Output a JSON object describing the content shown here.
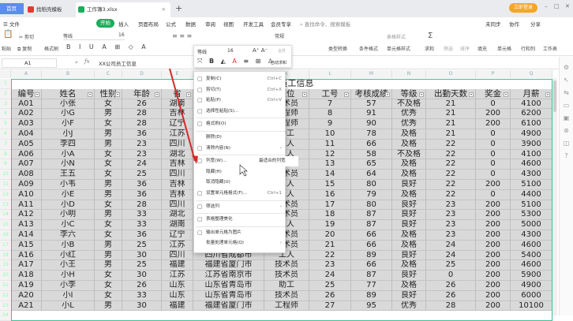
{
  "tabs": {
    "home": "首页",
    "docer": "找稻壳模板",
    "book": "工作簿3.xlsx",
    "login": "立即登录"
  },
  "menubar": {
    "file": "文件",
    "items": [
      "开始",
      "插入",
      "页面布局",
      "公式",
      "数据",
      "审阅",
      "视图",
      "开发工具",
      "会员专享"
    ],
    "search": "查找命令、搜索模板",
    "sync": "未同步",
    "collab": "协作",
    "share": "分享"
  },
  "ribbon": {
    "paste": "粘贴",
    "cut": "剪切",
    "copy": "复制",
    "format_painter": "格式刷",
    "font": "等线",
    "size": "16",
    "number_format": "常规",
    "convert": "类型转换",
    "cond_format": "条件格式",
    "table_style": "表格样式",
    "cell_style": "单元格样式",
    "sum": "求和",
    "filter": "筛选",
    "sort": "排序",
    "fill": "填充",
    "cells": "单元格",
    "rowcol": "行和列",
    "sheet": "工作表"
  },
  "formula": {
    "cell_ref": "A1",
    "fx": "fx",
    "value": "XX公司员工信息"
  },
  "mini_toolbar": {
    "font": "等线",
    "size": "16",
    "merge": "合并",
    "autosum": "自动求和"
  },
  "sheet": {
    "col_letters": [
      "A",
      "B",
      "C",
      "D",
      "E",
      "F",
      "K",
      "L",
      "M",
      "N",
      "O",
      "P",
      "Q"
    ],
    "title": "XX公司员工信息",
    "headers": [
      "编号",
      "姓名",
      "性别",
      "年龄",
      "省",
      "",
      "职位",
      "工号",
      "考核成绩",
      "等级",
      "出勤天数",
      "奖金",
      "月薪"
    ],
    "rows": [
      [
        "A01",
        "小张",
        "女",
        "26",
        "湖南",
        "",
        "技术员",
        "7",
        "57",
        "不及格",
        "21",
        "0",
        "4100"
      ],
      [
        "A02",
        "小G",
        "男",
        "28",
        "吉林",
        "",
        "工程师",
        "8",
        "91",
        "优秀",
        "21",
        "200",
        "6200"
      ],
      [
        "A03",
        "小F",
        "女",
        "28",
        "辽宁",
        "",
        "工程师",
        "9",
        "90",
        "优秀",
        "21",
        "200",
        "6100"
      ],
      [
        "A04",
        "小J",
        "男",
        "36",
        "江苏",
        "",
        "助工",
        "10",
        "78",
        "及格",
        "21",
        "0",
        "4900"
      ],
      [
        "A05",
        "李四",
        "男",
        "23",
        "四川",
        "",
        "工人",
        "11",
        "66",
        "及格",
        "22",
        "0",
        "3900"
      ],
      [
        "A06",
        "小A",
        "女",
        "23",
        "湖北",
        "",
        "工人",
        "12",
        "58",
        "不及格",
        "22",
        "0",
        "4100"
      ],
      [
        "A07",
        "小N",
        "女",
        "24",
        "吉林",
        "",
        "工人",
        "13",
        "65",
        "及格",
        "22",
        "0",
        "4600"
      ],
      [
        "A08",
        "王五",
        "女",
        "25",
        "四川",
        "",
        "技术员",
        "14",
        "64",
        "及格",
        "22",
        "0",
        "4300"
      ],
      [
        "A09",
        "小韦",
        "男",
        "36",
        "吉林",
        "",
        "工人",
        "15",
        "80",
        "良好",
        "22",
        "200",
        "5100"
      ],
      [
        "A10",
        "小E",
        "男",
        "36",
        "吉林",
        "",
        "工人",
        "16",
        "79",
        "及格",
        "22",
        "0",
        "4400"
      ],
      [
        "A11",
        "小D",
        "女",
        "28",
        "四川",
        "",
        "技术员",
        "17",
        "80",
        "良好",
        "23",
        "200",
        "5100"
      ],
      [
        "A12",
        "小明",
        "男",
        "33",
        "湖北",
        "",
        "技术员",
        "18",
        "87",
        "良好",
        "23",
        "200",
        "5300"
      ],
      [
        "A13",
        "小C",
        "女",
        "33",
        "湖南",
        "",
        "工人",
        "19",
        "87",
        "良好",
        "23",
        "200",
        "5000"
      ],
      [
        "A14",
        "李六",
        "女",
        "36",
        "辽宁",
        "",
        "技术员",
        "20",
        "66",
        "及格",
        "23",
        "200",
        "4300"
      ],
      [
        "A15",
        "小B",
        "男",
        "25",
        "江苏",
        "",
        "技术员",
        "21",
        "66",
        "及格",
        "24",
        "200",
        "4600"
      ],
      [
        "A16",
        "小红",
        "男",
        "30",
        "四川",
        "四川省成都市",
        "工人",
        "22",
        "89",
        "良好",
        "24",
        "200",
        "5400"
      ],
      [
        "A17",
        "小王",
        "男",
        "25",
        "福建",
        "福建省厦门市",
        "技术员",
        "23",
        "66",
        "及格",
        "25",
        "200",
        "4600"
      ],
      [
        "A18",
        "小H",
        "女",
        "30",
        "江苏",
        "江苏省南京市",
        "技术员",
        "24",
        "87",
        "良好",
        "0",
        "200",
        "5900"
      ],
      [
        "A19",
        "小李",
        "女",
        "26",
        "山东",
        "山东省青岛市",
        "助工",
        "25",
        "77",
        "及格",
        "26",
        "200",
        "4900"
      ],
      [
        "A20",
        "小I",
        "女",
        "33",
        "山东",
        "山东省青岛市",
        "技术员",
        "26",
        "89",
        "良好",
        "26",
        "200",
        "6000"
      ],
      [
        "A21",
        "小L",
        "男",
        "30",
        "福建",
        "福建省厦门市",
        "工程师",
        "27",
        "95",
        "优秀",
        "28",
        "200",
        "10100"
      ]
    ]
  },
  "context_menu": {
    "items": [
      {
        "label": "复制(C)",
        "shortcut": "Ctrl+C",
        "icon": "copy-icon"
      },
      {
        "label": "剪切(T)",
        "shortcut": "Ctrl+X",
        "icon": "cut-icon"
      },
      {
        "label": "粘贴(P)",
        "shortcut": "Ctrl+V",
        "icon": "paste-icon"
      },
      {
        "label": "选择性粘贴(S)...",
        "shortcut": "",
        "icon": "paste-special-icon"
      },
      {
        "label": "格式刷(O)",
        "shortcut": "",
        "icon": "format-painter-icon"
      },
      {
        "label": "删除(D)",
        "shortcut": "",
        "icon": ""
      },
      {
        "label": "清除内容(N)",
        "shortcut": "",
        "icon": "clear-icon"
      },
      {
        "label": "列宽(W)...",
        "shortcut": "",
        "icon": "column-width-icon"
      },
      {
        "label": "隐藏(H)",
        "shortcut": "",
        "icon": ""
      },
      {
        "label": "取消隐藏(U)",
        "shortcut": "",
        "icon": ""
      },
      {
        "label": "设置单元格格式(F)...",
        "shortcut": "Ctrl+1",
        "icon": "format-cells-icon"
      },
      {
        "label": "筛选列",
        "shortcut": "",
        "icon": "filter-icon"
      },
      {
        "label": "表格整理美化",
        "shortcut": "",
        "icon": "beautify-icon"
      },
      {
        "label": "输出单元格为图片",
        "shortcut": "",
        "icon": "image-icon"
      },
      {
        "label": "批量处理单元格(Q)",
        "shortcut": "",
        "icon": ""
      }
    ],
    "best_fit": "最适合的列宽"
  },
  "colors": {
    "accent": "#1aad5b",
    "selection": "#3fbf95",
    "cell_fill": "#d9d9d9",
    "arrow": "#d42a2a"
  }
}
